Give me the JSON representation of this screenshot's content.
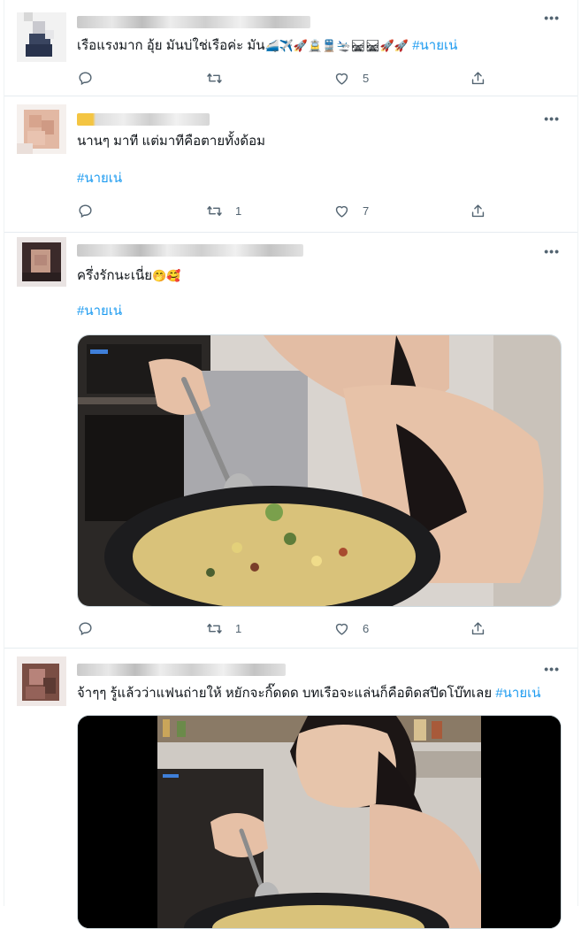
{
  "tweets": [
    {
      "text_main": "เรือแรงมาก อุ้ย มันบ่ใช่เรือค่ะ มัน",
      "emojis": "🚄✈️🚀🚊🚆🛬🛤🛤🚀🚀",
      "hashtag": "#นายเน่",
      "reply_count": "",
      "retweet_count": "",
      "like_count": "5"
    },
    {
      "text_main": "นานๆ มาที แต่มาทีคือตายทั้งด้อม",
      "hashtag": "#นายเน่",
      "reply_count": "",
      "retweet_count": "1",
      "like_count": "7"
    },
    {
      "text_main": "ครึ่งรักนะเนี่ย",
      "emojis": "🤭🥰",
      "hashtag": "#นายเน่",
      "reply_count": "",
      "retweet_count": "1",
      "like_count": "6"
    },
    {
      "text_main": "จ้าๆๆ รู้แล้วว่าแฟนถ่ายให้ หยักจะกิ๊ดดด บทเรือจะแล่นก็คือติดสปีดโบ๊ทเลย",
      "hashtag": "#นายเน่"
    }
  ],
  "icons": {
    "more": "more-icon",
    "reply": "reply-icon",
    "retweet": "retweet-icon",
    "like": "like-icon",
    "share": "share-icon"
  },
  "colors": {
    "hashtag": "#1d9bf0",
    "secondary": "#536471",
    "divider": "#e6ecf0"
  }
}
